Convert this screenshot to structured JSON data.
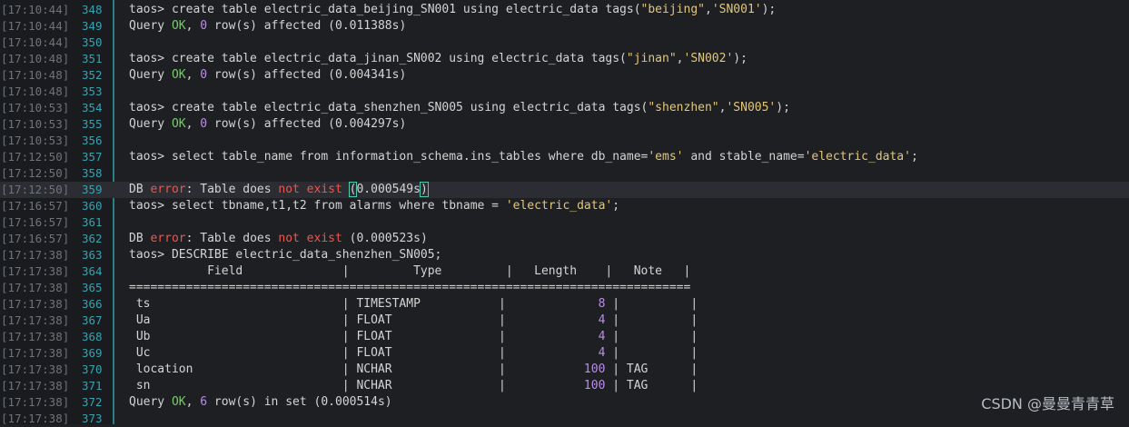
{
  "watermark": "CSDN @曼曼青青草",
  "lines": [
    {
      "ts": "[17:10:44]",
      "n": "348",
      "kind": "cmd",
      "text": "create table electric_data_beijing_SN001 using electric_data tags(\"beijing\",'SN001');"
    },
    {
      "ts": "[17:10:44]",
      "n": "349",
      "kind": "ok",
      "rows": "0",
      "time": "0.011388s"
    },
    {
      "ts": "[17:10:44]",
      "n": "350",
      "kind": "blank"
    },
    {
      "ts": "[17:10:48]",
      "n": "351",
      "kind": "cmd",
      "text": "create table electric_data_jinan_SN002 using electric_data tags(\"jinan\",'SN002');"
    },
    {
      "ts": "[17:10:48]",
      "n": "352",
      "kind": "ok",
      "rows": "0",
      "time": "0.004341s"
    },
    {
      "ts": "[17:10:48]",
      "n": "353",
      "kind": "blank"
    },
    {
      "ts": "[17:10:53]",
      "n": "354",
      "kind": "cmd",
      "text": "create table electric_data_shenzhen_SN005 using electric_data tags(\"shenzhen\",'SN005');"
    },
    {
      "ts": "[17:10:53]",
      "n": "355",
      "kind": "ok",
      "rows": "0",
      "time": "0.004297s"
    },
    {
      "ts": "[17:10:53]",
      "n": "356",
      "kind": "blank"
    },
    {
      "ts": "[17:12:50]",
      "n": "357",
      "kind": "cmd",
      "text": "select table_name from information_schema.ins_tables where db_name='ems' and stable_name='electric_data';"
    },
    {
      "ts": "[17:12:50]",
      "n": "358",
      "kind": "blank"
    },
    {
      "ts": "[17:12:50]",
      "n": "359",
      "kind": "err",
      "time": "0.000549s",
      "cursor": true
    },
    {
      "ts": "[17:16:57]",
      "n": "360",
      "kind": "cmd",
      "text": "select tbname,t1,t2 from alarms where tbname = 'electric_data';"
    },
    {
      "ts": "[17:16:57]",
      "n": "361",
      "kind": "blank"
    },
    {
      "ts": "[17:16:57]",
      "n": "362",
      "kind": "err",
      "time": "0.000523s"
    },
    {
      "ts": "[17:17:38]",
      "n": "363",
      "kind": "cmd",
      "text": "DESCRIBE electric_data_shenzhen_SN005;"
    },
    {
      "ts": "[17:17:38]",
      "n": "364",
      "kind": "thead",
      "cols": [
        "Field",
        "Type",
        "Length",
        "Note"
      ]
    },
    {
      "ts": "[17:17:38]",
      "n": "365",
      "kind": "rule"
    },
    {
      "ts": "[17:17:38]",
      "n": "366",
      "kind": "row",
      "field": "ts",
      "type": "TIMESTAMP",
      "len": "8",
      "note": ""
    },
    {
      "ts": "[17:17:38]",
      "n": "367",
      "kind": "row",
      "field": "Ua",
      "type": "FLOAT",
      "len": "4",
      "note": ""
    },
    {
      "ts": "[17:17:38]",
      "n": "368",
      "kind": "row",
      "field": "Ub",
      "type": "FLOAT",
      "len": "4",
      "note": ""
    },
    {
      "ts": "[17:17:38]",
      "n": "369",
      "kind": "row",
      "field": "Uc",
      "type": "FLOAT",
      "len": "4",
      "note": ""
    },
    {
      "ts": "[17:17:38]",
      "n": "370",
      "kind": "row",
      "field": "location",
      "type": "NCHAR",
      "len": "100",
      "note": "TAG"
    },
    {
      "ts": "[17:17:38]",
      "n": "371",
      "kind": "row",
      "field": "sn",
      "type": "NCHAR",
      "len": "100",
      "note": "TAG"
    },
    {
      "ts": "[17:17:38]",
      "n": "372",
      "kind": "okset",
      "rows": "6",
      "time": "0.000514s"
    },
    {
      "ts": "[17:17:38]",
      "n": "373",
      "kind": "blank"
    }
  ],
  "strings": {
    "prompt": "taos> ",
    "query": "Query ",
    "ok": "OK",
    "rowsAffected": " row(s) affected ",
    "rowsInSet": " row(s) in set ",
    "dbError": "DB ",
    "error": "error",
    "tableDoes": ": Table does ",
    "notExist": "not exist",
    "rule": "==============================================================================="
  },
  "colors": {
    "background": "#1e1f22",
    "prompt_ok": "#7ac86e",
    "number": "#b98ee6",
    "string": "#e2c77a",
    "error": "#f0544f",
    "line_number": "#36a3b0"
  }
}
